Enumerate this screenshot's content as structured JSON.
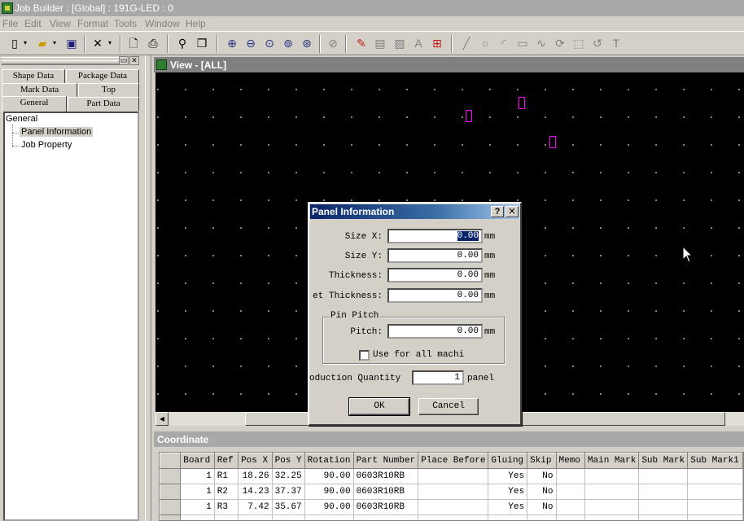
{
  "app": {
    "title": "Job Builder : [Global] : 191G-LED : 0"
  },
  "menu": [
    "File",
    "Edit",
    "View",
    "Format",
    "Tools",
    "Window",
    "Help"
  ],
  "left_panel": {
    "tabs_row1": [
      "Shape Data",
      "Package Data"
    ],
    "tabs_row2": [
      "Mark Data",
      "Top"
    ],
    "tabs_row3": [
      "General",
      "Part Data"
    ],
    "tree": {
      "root": "General",
      "children": [
        "Panel Information",
        "Job Property"
      ],
      "selected": "Panel Information"
    }
  },
  "view": {
    "title": "View - [ALL]"
  },
  "coordinate": {
    "title": "Coordinate",
    "columns": [
      "Board",
      "Ref",
      "Pos X",
      "Pos Y",
      "Rotation",
      "Part Number",
      "Place Before",
      "Gluing",
      "Skip",
      "Memo",
      "Main Mark",
      "Sub Mark",
      "Sub Mark1"
    ],
    "rows": [
      [
        "1",
        "R1",
        "18.26",
        "32.25",
        "90.00",
        "0603R10RB",
        "",
        "Yes",
        "No",
        "",
        "",
        "",
        ""
      ],
      [
        "1",
        "R2",
        "14.23",
        "37.37",
        "90.00",
        "0603R10RB",
        "",
        "Yes",
        "No",
        "",
        "",
        "",
        ""
      ],
      [
        "1",
        "R3",
        "7.42",
        "35.67",
        "90.00",
        "0603R10RB",
        "",
        "Yes",
        "No",
        "",
        "",
        "",
        ""
      ]
    ],
    "new_row_marker": "✳"
  },
  "dialog": {
    "title": "Panel Information",
    "help_btn": "?",
    "close_btn": "✕",
    "size_x_label": "Size X:",
    "size_x_value": "0.00",
    "size_y_label": "Size Y:",
    "size_y_value": "0.00",
    "thickness_label": "Thickness:",
    "thickness_value": "0.00",
    "set_thickness_label": "et Thickness:",
    "set_thickness_value": "0.00",
    "unit": "mm",
    "group_label": "Pin Pitch",
    "pitch_label": "Pitch:",
    "pitch_value": "0.00",
    "use_all_label": "Use for all machi",
    "prod_qty_label": "oduction Quantity :",
    "prod_qty_value": "1",
    "prod_qty_unit": "panel",
    "ok": "OK",
    "cancel": "Cancel"
  }
}
